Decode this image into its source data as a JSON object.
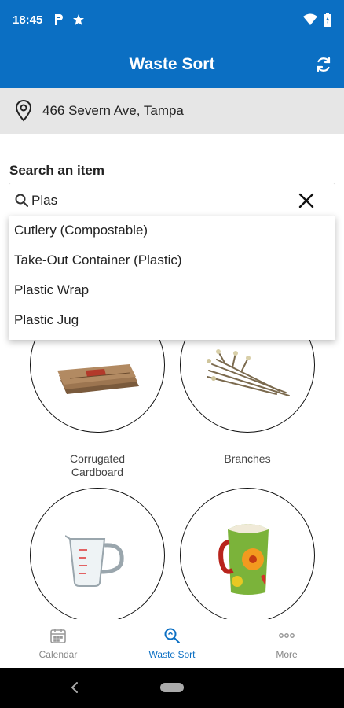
{
  "status_bar": {
    "time": "18:45",
    "left_icons": [
      "parking-icon",
      "star-icon"
    ],
    "right_icons": [
      "wifi-icon",
      "battery-icon"
    ]
  },
  "app_bar": {
    "title": "Waste Sort",
    "refresh_icon": "refresh-icon"
  },
  "address": {
    "icon": "location-pin-icon",
    "text": "466 Severn Ave, Tampa"
  },
  "search": {
    "label": "Search an item",
    "value": "Plas",
    "icon": "search-icon",
    "clear_icon": "close-icon",
    "suggestions": [
      "Cutlery (Compostable)",
      "Take-Out Container (Plastic)",
      "Plastic Wrap",
      "Plastic Jug"
    ]
  },
  "items": [
    {
      "label_line1": "Corrugated",
      "label_line2": "Cardboard",
      "image": "cardboard-image"
    },
    {
      "label_line1": "Branches",
      "label_line2": "",
      "image": "branches-image"
    },
    {
      "label_line1": "",
      "label_line2": "",
      "image": "measuring-cup-image"
    },
    {
      "label_line1": "",
      "label_line2": "",
      "image": "mug-image"
    }
  ],
  "bottom_nav": [
    {
      "label": "Calendar",
      "icon": "calendar-icon",
      "active": false
    },
    {
      "label": "Waste Sort",
      "icon": "waste-sort-search-icon",
      "active": true
    },
    {
      "label": "More",
      "icon": "more-dots-icon",
      "active": false
    }
  ],
  "colors": {
    "primary": "#0b6fc3",
    "address_bg": "#e6e6e6",
    "nav_inactive": "#888888"
  }
}
